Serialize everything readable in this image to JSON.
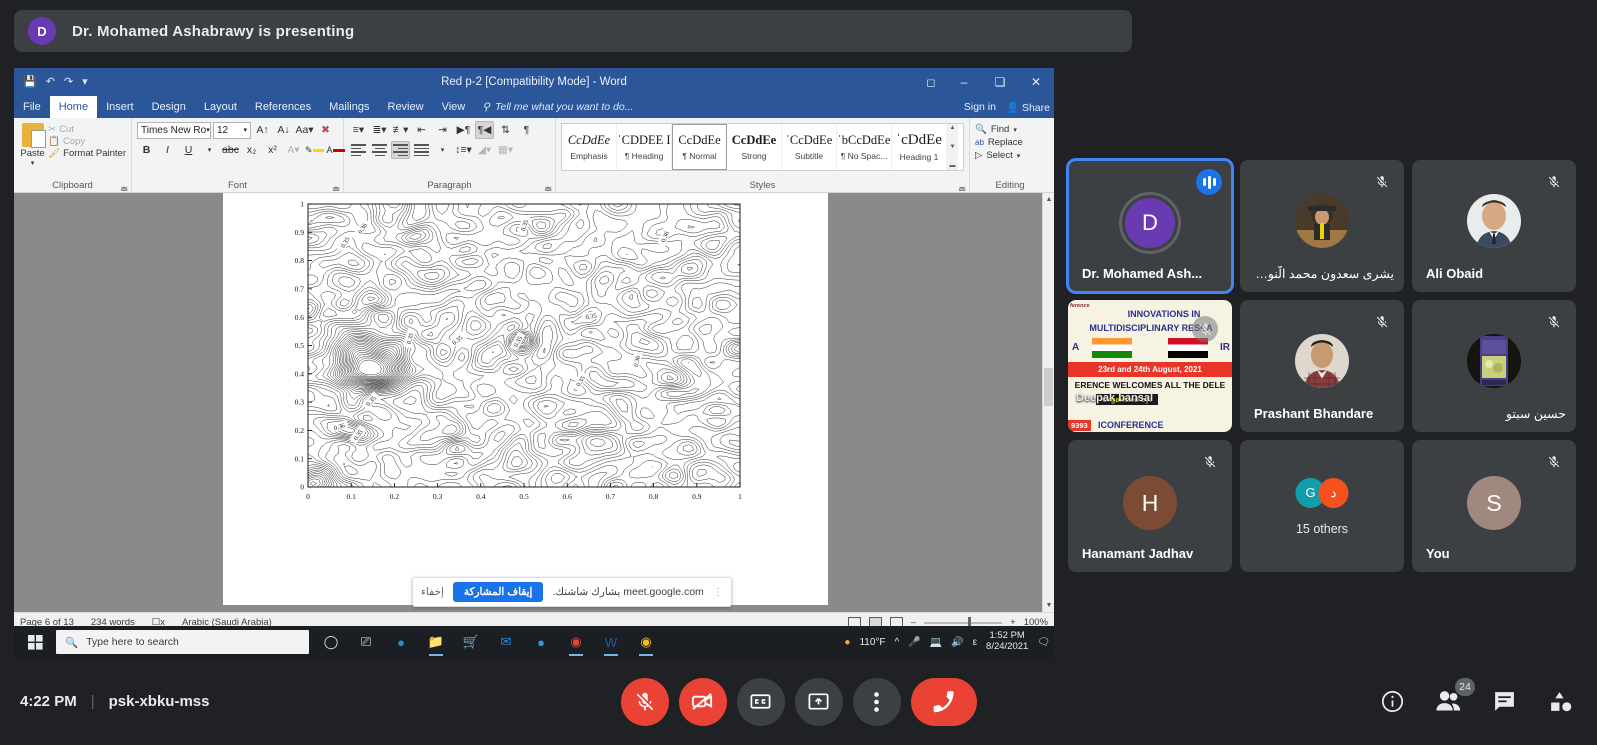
{
  "meet": {
    "banner": {
      "avatar_letter": "D",
      "text": "Dr. Mohamed Ashabrawy is presenting"
    },
    "bottom": {
      "time": "4:22 PM",
      "separator": "|",
      "meeting_code": "psk-xbku-mss",
      "controls": [
        {
          "name": "microphone-off",
          "label": "Turn on microphone",
          "state": "muted"
        },
        {
          "name": "camera-off",
          "label": "Turn on camera",
          "state": "off"
        },
        {
          "name": "closed-captions",
          "label": "Turn on captions",
          "state": "off"
        },
        {
          "name": "present-screen",
          "label": "Present now",
          "state": "on"
        },
        {
          "name": "more-options",
          "label": "More options",
          "state": "off"
        },
        {
          "name": "leave-call",
          "label": "Leave call",
          "state": "on"
        }
      ],
      "right_icons": [
        {
          "name": "meeting-details",
          "label": "Meeting details"
        },
        {
          "name": "show-everyone",
          "label": "Show everyone",
          "badge": "24"
        },
        {
          "name": "chat",
          "label": "Chat with everyone"
        },
        {
          "name": "activities",
          "label": "Activities"
        }
      ]
    },
    "participants": [
      {
        "name": "Dr. Mohamed Ash...",
        "avatar_letter": "D",
        "avatar_color": "#6a3ab2",
        "kind": "letter",
        "active_speaker": true,
        "muted": false,
        "rtl": false
      },
      {
        "name": "يشرى سعدون محمد الّنوري",
        "kind": "photo",
        "photo": "woman-graduation",
        "active_speaker": false,
        "muted": true,
        "rtl": true
      },
      {
        "name": "Ali Obaid",
        "kind": "photo",
        "photo": "man-suit",
        "active_speaker": false,
        "muted": true,
        "rtl": false
      },
      {
        "name": "Deepak bansal",
        "kind": "slide",
        "active_speaker": false,
        "muted": true,
        "rtl": false
      },
      {
        "name": "Prashant Bhandare",
        "kind": "photo",
        "photo": "man-plaid",
        "active_speaker": false,
        "muted": true,
        "rtl": false
      },
      {
        "name": "حسين سبتو",
        "kind": "photo",
        "photo": "book-cover",
        "active_speaker": false,
        "muted": true,
        "rtl": true
      },
      {
        "name": "Hanamant Jadhav",
        "avatar_letter": "H",
        "avatar_color": "#7d4b35",
        "kind": "letter",
        "active_speaker": false,
        "muted": true,
        "rtl": false
      },
      {
        "name": "15 others",
        "kind": "others",
        "stack": [
          {
            "letter": "G",
            "color": "#109eab"
          },
          {
            "letter": "د",
            "color": "#f4511e"
          }
        ],
        "active_speaker": false,
        "muted": false,
        "rtl": false
      },
      {
        "name": "You",
        "avatar_letter": "S",
        "avatar_color": "#a1887f",
        "kind": "letter",
        "active_speaker": false,
        "muted": true,
        "rtl": false
      }
    ],
    "slide_tile": {
      "line1": "INNOVATIONS IN",
      "line2": "MULTIDISCIPLINARY RESEA",
      "left_letter": "A",
      "right_letter": "IR",
      "date": "23rd and 24th August, 2021",
      "welcome": "ERENCE WELCOMES ALL THE DELE",
      "organized": "Organized by:",
      "conference": "ICONFERENCE",
      "badge": "9393",
      "corner": "ference"
    }
  },
  "word": {
    "title": "Red p-2 [Compatibility Mode] - Word",
    "quick_access": [
      "save-icon",
      "undo-icon",
      "redo-icon",
      "customize-qat-icon"
    ],
    "window_buttons": [
      "ribbon-display-options",
      "minimize",
      "restore",
      "close"
    ],
    "tabs": [
      "File",
      "Home",
      "Insert",
      "Design",
      "Layout",
      "References",
      "Mailings",
      "Review",
      "View"
    ],
    "active_tab": "Home",
    "tell_me": "Tell me what you want to do...",
    "sign_in": "Sign in",
    "share": "Share",
    "groups": {
      "clipboard": {
        "label": "Clipboard",
        "paste": "Paste",
        "items": [
          "Cut",
          "Copy",
          "Format Painter"
        ]
      },
      "font": {
        "label": "Font",
        "font_name": "Times New Ro",
        "font_size": "12"
      },
      "paragraph": {
        "label": "Paragraph"
      },
      "styles": {
        "label": "Styles",
        "items": [
          {
            "preview": "CcDdEe",
            "name": "Emphasis",
            "selected": false
          },
          {
            "preview": "ˈCDDEE  I",
            "name": "¶ Heading",
            "selected": false
          },
          {
            "preview": "CcDdEe",
            "name": "¶ Normal",
            "selected": true
          },
          {
            "preview": "CcDdEe",
            "name": "Strong",
            "selected": false
          },
          {
            "preview": "ˈCcDdEe",
            "name": "Subtitle",
            "selected": false
          },
          {
            "preview": "ˈbCcDdEe",
            "name": "¶ No Spac...",
            "selected": false
          },
          {
            "preview": "ˈcDdEe",
            "name": "Heading 1",
            "selected": false
          }
        ]
      },
      "editing": {
        "label": "Editing",
        "items": [
          "Find",
          "Replace",
          "Select"
        ]
      }
    },
    "status": {
      "page": "Page 6 of 13",
      "words": "234 words",
      "proofing": "proofing-icon",
      "language": "Arabic (Saudi Arabia)",
      "zoom": "100%"
    },
    "share_bar": {
      "message": "meet.google.com يشارك شاشتك.",
      "stop_label": "إيقاف المشاركة",
      "hide_label": "إخفاء"
    }
  },
  "taskbar": {
    "search_placeholder": "Type here to search",
    "icons": [
      "cortana-icon",
      "task-view-icon",
      "edge-icon",
      "file-explorer-icon",
      "store-icon",
      "mail-icon",
      "edge2-icon",
      "chrome-icon",
      "word-icon",
      "chrome2-icon"
    ],
    "tray": {
      "weather": "110°F",
      "chevron": "show-hidden-icons",
      "mic": "microphone-icon",
      "network": "network-icon",
      "volume": "volume-icon",
      "ime": "ε",
      "time": "1:52 PM",
      "date": "8/24/2021",
      "notifications": "action-center-icon"
    }
  },
  "chart_data": {
    "type": "line",
    "subtype": "contour",
    "title": "",
    "xlabel": "",
    "ylabel": "",
    "xlim": [
      0,
      1
    ],
    "ylim": [
      0,
      1
    ],
    "xticks": [
      "0",
      "0.1",
      "0.2",
      "0.3",
      "0.4",
      "0.5",
      "0.6",
      "0.7",
      "0.8",
      "0.9",
      "1"
    ],
    "yticks": [
      "0",
      "0.1",
      "0.2",
      "0.3",
      "0.4",
      "0.5",
      "0.6",
      "0.7",
      "0.8",
      "0.9",
      "1"
    ],
    "grid": false,
    "legend": "none",
    "contour_labels": [
      "0.36",
      "0.35",
      "0.35",
      "0.36",
      "0.35",
      "0.35",
      "0.35",
      "0.35",
      "0.36",
      "0.35",
      "0.35",
      "0.36",
      "0.35"
    ],
    "contour_levels": [
      0.35,
      0.36
    ],
    "description": "Dense iso-contour map of a noisy 2-D scalar field over the unit square with a concentrated high-gradient cluster near x=0.1-0.2, y=0.4-0.55 and a small closed eye near x=0.5, y=0.52"
  }
}
